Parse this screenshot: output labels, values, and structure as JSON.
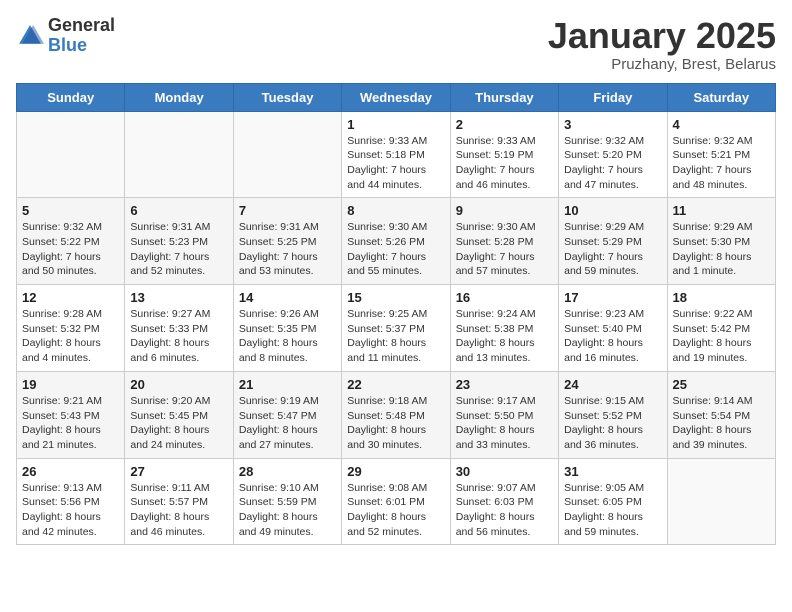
{
  "header": {
    "logo_line1": "General",
    "logo_line2": "Blue",
    "title": "January 2025",
    "subtitle": "Pruzhany, Brest, Belarus"
  },
  "days_of_week": [
    "Sunday",
    "Monday",
    "Tuesday",
    "Wednesday",
    "Thursday",
    "Friday",
    "Saturday"
  ],
  "weeks": [
    [
      {
        "day": "",
        "info": ""
      },
      {
        "day": "",
        "info": ""
      },
      {
        "day": "",
        "info": ""
      },
      {
        "day": "1",
        "info": "Sunrise: 9:33 AM\nSunset: 5:18 PM\nDaylight: 7 hours\nand 44 minutes."
      },
      {
        "day": "2",
        "info": "Sunrise: 9:33 AM\nSunset: 5:19 PM\nDaylight: 7 hours\nand 46 minutes."
      },
      {
        "day": "3",
        "info": "Sunrise: 9:32 AM\nSunset: 5:20 PM\nDaylight: 7 hours\nand 47 minutes."
      },
      {
        "day": "4",
        "info": "Sunrise: 9:32 AM\nSunset: 5:21 PM\nDaylight: 7 hours\nand 48 minutes."
      }
    ],
    [
      {
        "day": "5",
        "info": "Sunrise: 9:32 AM\nSunset: 5:22 PM\nDaylight: 7 hours\nand 50 minutes."
      },
      {
        "day": "6",
        "info": "Sunrise: 9:31 AM\nSunset: 5:23 PM\nDaylight: 7 hours\nand 52 minutes."
      },
      {
        "day": "7",
        "info": "Sunrise: 9:31 AM\nSunset: 5:25 PM\nDaylight: 7 hours\nand 53 minutes."
      },
      {
        "day": "8",
        "info": "Sunrise: 9:30 AM\nSunset: 5:26 PM\nDaylight: 7 hours\nand 55 minutes."
      },
      {
        "day": "9",
        "info": "Sunrise: 9:30 AM\nSunset: 5:28 PM\nDaylight: 7 hours\nand 57 minutes."
      },
      {
        "day": "10",
        "info": "Sunrise: 9:29 AM\nSunset: 5:29 PM\nDaylight: 7 hours\nand 59 minutes."
      },
      {
        "day": "11",
        "info": "Sunrise: 9:29 AM\nSunset: 5:30 PM\nDaylight: 8 hours\nand 1 minute."
      }
    ],
    [
      {
        "day": "12",
        "info": "Sunrise: 9:28 AM\nSunset: 5:32 PM\nDaylight: 8 hours\nand 4 minutes."
      },
      {
        "day": "13",
        "info": "Sunrise: 9:27 AM\nSunset: 5:33 PM\nDaylight: 8 hours\nand 6 minutes."
      },
      {
        "day": "14",
        "info": "Sunrise: 9:26 AM\nSunset: 5:35 PM\nDaylight: 8 hours\nand 8 minutes."
      },
      {
        "day": "15",
        "info": "Sunrise: 9:25 AM\nSunset: 5:37 PM\nDaylight: 8 hours\nand 11 minutes."
      },
      {
        "day": "16",
        "info": "Sunrise: 9:24 AM\nSunset: 5:38 PM\nDaylight: 8 hours\nand 13 minutes."
      },
      {
        "day": "17",
        "info": "Sunrise: 9:23 AM\nSunset: 5:40 PM\nDaylight: 8 hours\nand 16 minutes."
      },
      {
        "day": "18",
        "info": "Sunrise: 9:22 AM\nSunset: 5:42 PM\nDaylight: 8 hours\nand 19 minutes."
      }
    ],
    [
      {
        "day": "19",
        "info": "Sunrise: 9:21 AM\nSunset: 5:43 PM\nDaylight: 8 hours\nand 21 minutes."
      },
      {
        "day": "20",
        "info": "Sunrise: 9:20 AM\nSunset: 5:45 PM\nDaylight: 8 hours\nand 24 minutes."
      },
      {
        "day": "21",
        "info": "Sunrise: 9:19 AM\nSunset: 5:47 PM\nDaylight: 8 hours\nand 27 minutes."
      },
      {
        "day": "22",
        "info": "Sunrise: 9:18 AM\nSunset: 5:48 PM\nDaylight: 8 hours\nand 30 minutes."
      },
      {
        "day": "23",
        "info": "Sunrise: 9:17 AM\nSunset: 5:50 PM\nDaylight: 8 hours\nand 33 minutes."
      },
      {
        "day": "24",
        "info": "Sunrise: 9:15 AM\nSunset: 5:52 PM\nDaylight: 8 hours\nand 36 minutes."
      },
      {
        "day": "25",
        "info": "Sunrise: 9:14 AM\nSunset: 5:54 PM\nDaylight: 8 hours\nand 39 minutes."
      }
    ],
    [
      {
        "day": "26",
        "info": "Sunrise: 9:13 AM\nSunset: 5:56 PM\nDaylight: 8 hours\nand 42 minutes."
      },
      {
        "day": "27",
        "info": "Sunrise: 9:11 AM\nSunset: 5:57 PM\nDaylight: 8 hours\nand 46 minutes."
      },
      {
        "day": "28",
        "info": "Sunrise: 9:10 AM\nSunset: 5:59 PM\nDaylight: 8 hours\nand 49 minutes."
      },
      {
        "day": "29",
        "info": "Sunrise: 9:08 AM\nSunset: 6:01 PM\nDaylight: 8 hours\nand 52 minutes."
      },
      {
        "day": "30",
        "info": "Sunrise: 9:07 AM\nSunset: 6:03 PM\nDaylight: 8 hours\nand 56 minutes."
      },
      {
        "day": "31",
        "info": "Sunrise: 9:05 AM\nSunset: 6:05 PM\nDaylight: 8 hours\nand 59 minutes."
      },
      {
        "day": "",
        "info": ""
      }
    ]
  ]
}
